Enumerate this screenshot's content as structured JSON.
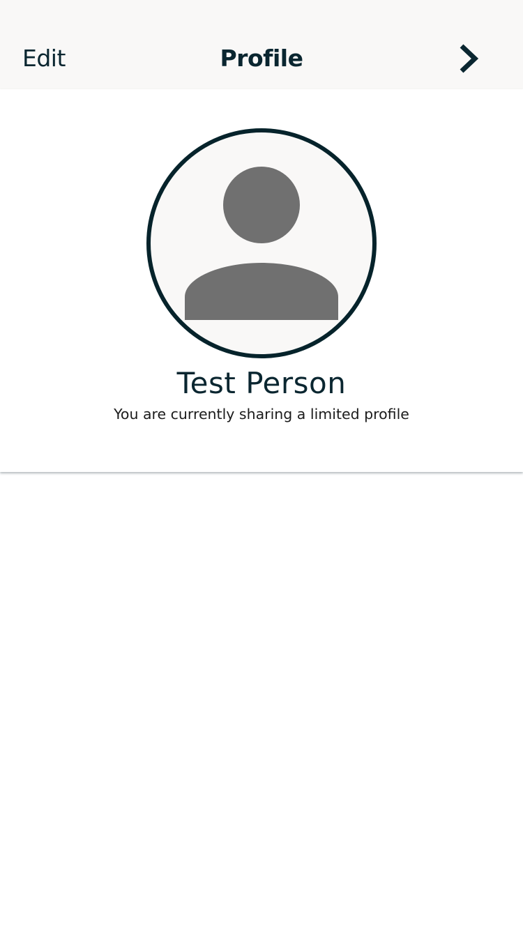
{
  "nav": {
    "edit_label": "Edit",
    "title": "Profile",
    "next_icon": "chevron-right-icon"
  },
  "profile": {
    "avatar_icon": "user-placeholder-icon",
    "name": "Test Person",
    "status": "You are currently sharing a limited profile"
  },
  "colors": {
    "nav_background": "#f9f8f7",
    "text_primary": "#0a2630",
    "avatar_ring": "#06232b",
    "avatar_fill": "#f9f8f7",
    "avatar_glyph": "#707070"
  }
}
